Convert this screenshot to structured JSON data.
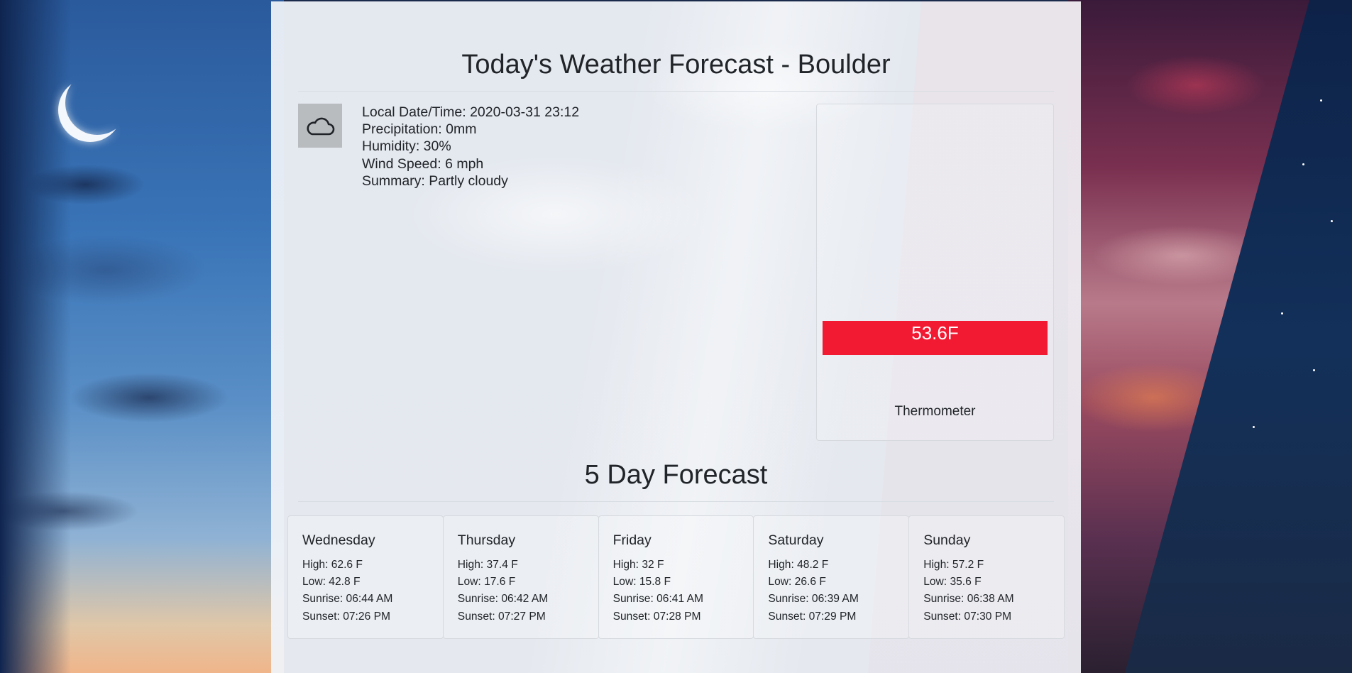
{
  "title": "Today's Weather Forecast - Boulder",
  "current": {
    "icon": "cloud-icon",
    "local_datetime": "Local Date/Time: 2020-03-31 23:12",
    "precipitation": "Precipitation: 0mm",
    "humidity": "Humidity: 30%",
    "wind_speed": "Wind Speed: 6 mph",
    "summary": "Summary: Partly cloudy"
  },
  "thermometer": {
    "value": "53.6F",
    "label": "Thermometer",
    "bar_color": "#f21a33"
  },
  "forecast": {
    "title": "5 Day Forecast",
    "days": [
      {
        "name": "Wednesday",
        "high": "High: 62.6 F",
        "low": "Low: 42.8 F",
        "sunrise": "Sunrise: 06:44 AM",
        "sunset": "Sunset: 07:26 PM"
      },
      {
        "name": "Thursday",
        "high": "High: 37.4 F",
        "low": "Low: 17.6 F",
        "sunrise": "Sunrise: 06:42 AM",
        "sunset": "Sunset: 07:27 PM"
      },
      {
        "name": "Friday",
        "high": "High: 32 F",
        "low": "Low: 15.8 F",
        "sunrise": "Sunrise: 06:41 AM",
        "sunset": "Sunset: 07:28 PM"
      },
      {
        "name": "Saturday",
        "high": "High: 48.2 F",
        "low": "Low: 26.6 F",
        "sunrise": "Sunrise: 06:39 AM",
        "sunset": "Sunset: 07:29 PM"
      },
      {
        "name": "Sunday",
        "high": "High: 57.2 F",
        "low": "Low: 35.6 F",
        "sunrise": "Sunrise: 06:38 AM",
        "sunset": "Sunset: 07:30 PM"
      }
    ]
  }
}
